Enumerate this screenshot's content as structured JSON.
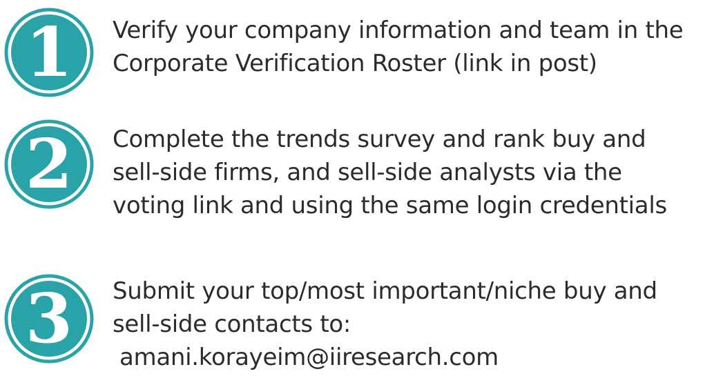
{
  "colors": {
    "badge_fill": "#2aa3a8",
    "badge_ring": "#2aa3a8",
    "text": "#2b2b2b"
  },
  "steps": [
    {
      "number": "1",
      "lines": [
        "Verify your company information and team in the",
        "Corporate Verification Roster (link in post)"
      ]
    },
    {
      "number": "2",
      "lines": [
        "Complete the trends survey and rank buy and",
        "sell-side firms, and sell-side analysts via the",
        "voting link and using the same login credentials"
      ]
    },
    {
      "number": "3",
      "lines": [
        "Submit your top/most important/niche buy and",
        "sell-side contacts to:",
        "amani.korayeim@iiresearch.com"
      ]
    }
  ]
}
